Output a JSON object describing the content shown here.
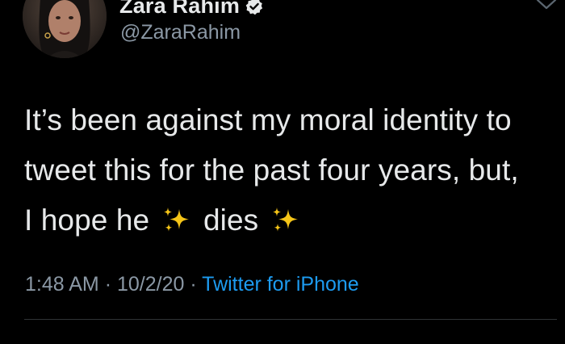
{
  "author": {
    "display_name": "Zara Rahim",
    "handle": "@ZaraRahim",
    "verified": true,
    "avatar_icon": "profile-photo"
  },
  "tweet": {
    "line1": "It’s been against my moral identity to",
    "line2": "tweet this for the past four years, but,",
    "line3_part1": "I hope he",
    "line3_part2": "dies",
    "emoji_icon": "sparkles-icon",
    "time": "1:48 AM",
    "separator": "·",
    "date": "10/2/20",
    "source": "Twitter for iPhone"
  },
  "colors": {
    "background": "#000000",
    "text": "#e7e9ea",
    "muted": "#8b98a5",
    "link": "#1d9bf0",
    "sparkle": "#f5c518"
  }
}
